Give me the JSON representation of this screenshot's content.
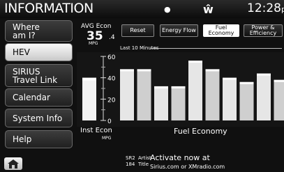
{
  "header": {
    "title": "INFORMATION",
    "clock": "12:28",
    "clock_suffix": "p"
  },
  "menu": {
    "items": [
      {
        "label": "Where\nam I?"
      },
      {
        "label": "HEV"
      },
      {
        "label": "SIRIUS\nTravel Link"
      },
      {
        "label": "Calendar"
      },
      {
        "label": "System Info"
      },
      {
        "label": "Help"
      }
    ]
  },
  "econ": {
    "label": "AVG Econ",
    "value": "35",
    "decimal": ".4",
    "unit": "MPG"
  },
  "buttons": {
    "reset": "Reset",
    "energy_flow": "Energy Flow",
    "fuel_economy": "Fuel\nEconomy",
    "power_efficiency": "Power &\nEfficiency"
  },
  "chart_label": "Last 10 Minutes",
  "chart_data": {
    "type": "bar",
    "ylim": [
      0,
      60
    ],
    "yticks": [
      "60",
      "40",
      "20",
      "0"
    ],
    "inst_value": 40,
    "values": [
      48,
      48,
      32,
      32,
      56,
      48,
      40,
      36,
      44,
      38
    ],
    "inst_label": "Inst Econ",
    "inst_unit": "MPG",
    "xlabel": "Fuel Economy"
  },
  "radio": {
    "channel": "SR2\n184",
    "meta": "Artist\nTitle",
    "message": "Activate now at",
    "url": "Sirius.com  or  XMradio.com"
  }
}
